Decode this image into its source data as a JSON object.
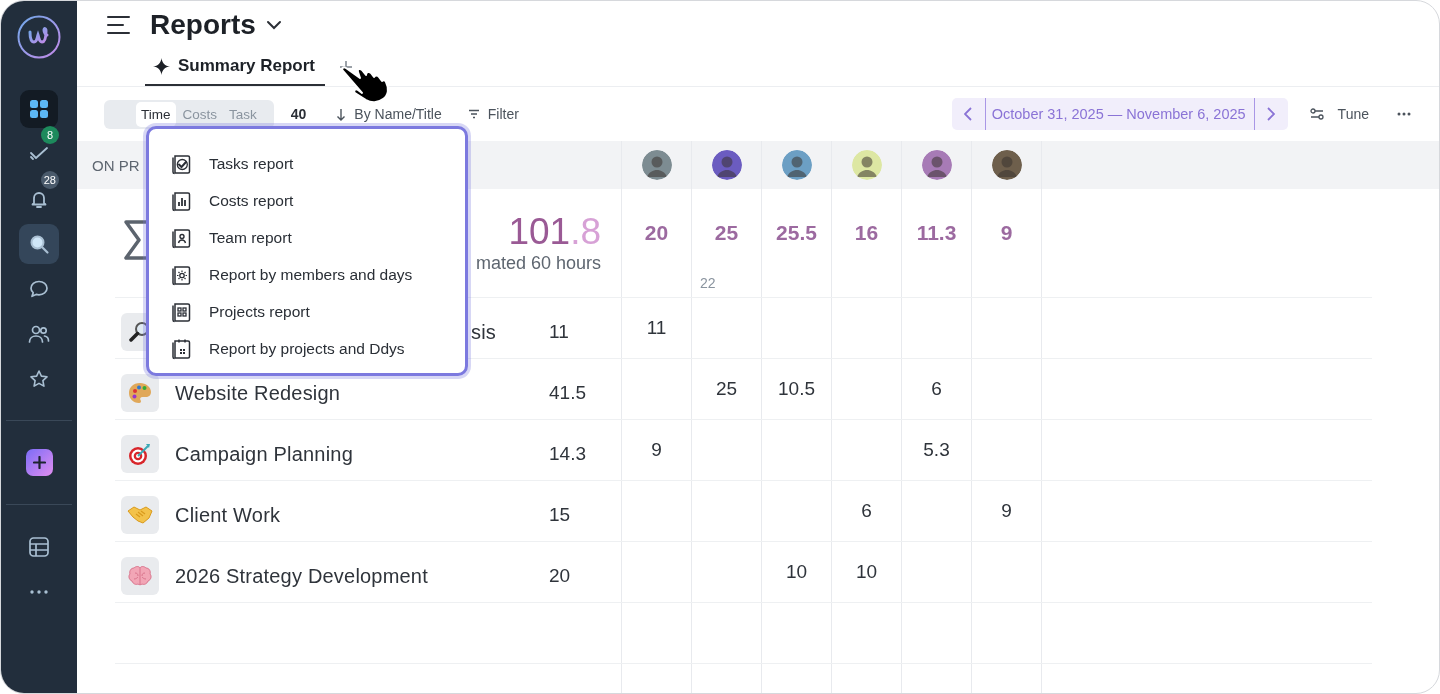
{
  "sidebar": {
    "groups": [
      [
        {
          "kind": "grid",
          "selected": true,
          "hovered": false
        },
        {
          "kind": "tasks",
          "selected": false,
          "hovered": false,
          "badge": "8"
        },
        {
          "kind": "bell",
          "selected": false,
          "hovered": false,
          "badge": "28"
        },
        {
          "kind": "search",
          "selected": false,
          "hovered": true
        },
        {
          "kind": "chat",
          "selected": false,
          "hovered": false
        },
        {
          "kind": "people",
          "selected": false,
          "hovered": false
        },
        {
          "kind": "star",
          "selected": false,
          "hovered": false
        }
      ],
      [
        {
          "kind": "add"
        }
      ],
      [
        {
          "kind": "table",
          "selected": false,
          "hovered": false
        },
        {
          "kind": "more",
          "selected": false,
          "hovered": false
        }
      ]
    ]
  },
  "header": {
    "title": "Reports"
  },
  "tabs": [
    {
      "label": "Summary Report",
      "selected": true
    }
  ],
  "toolbar": {
    "modes": [
      {
        "label": "Time",
        "selected": true
      },
      {
        "label": "Costs",
        "selected": false
      },
      {
        "label": "Task",
        "selected": false
      }
    ],
    "count": "40",
    "sort": "By Name/Title",
    "filter": "Filter",
    "date_range": "October 31, 2025 — November 6, 2025",
    "tune": "Tune"
  },
  "table": {
    "group_label": "ON PR",
    "members": [
      {
        "color": "#7d8c92"
      },
      {
        "color": "#6b5cc0"
      },
      {
        "color": "#6c9fc4"
      },
      {
        "color": "#dde7a3"
      },
      {
        "color": "#a77bb6"
      },
      {
        "color": "#6e5f4c"
      }
    ],
    "summary": {
      "total_whole": "101",
      "total_fraction": ".8",
      "estimate": "mated 60 hours",
      "member_totals": [
        {
          "value": "20"
        },
        {
          "value": "25",
          "sub": "22"
        },
        {
          "value": "25.5"
        },
        {
          "value": "16"
        },
        {
          "value": "11.3"
        },
        {
          "value": "9"
        }
      ]
    },
    "rows": [
      {
        "name": "sis",
        "covered": true,
        "total": "11",
        "values": {
          "member_1": "11"
        }
      },
      {
        "name": "Website Redesign",
        "covered": false,
        "total": "41.5",
        "values": {
          "member_2": "25",
          "member_3": "10.5",
          "member_5": "6"
        }
      },
      {
        "name": "Campaign Planning",
        "covered": false,
        "total": "14.3",
        "values": {
          "member_1": "9",
          "member_5": "5.3"
        }
      },
      {
        "name": "Client Work",
        "covered": false,
        "total": "15",
        "values": {
          "member_4": "6",
          "member_6": "9"
        }
      },
      {
        "name": "2026 Strategy Development",
        "covered": false,
        "total": "20",
        "values": {
          "member_3": "10",
          "member_4": "10"
        }
      }
    ]
  },
  "menu": {
    "items": [
      {
        "label": "Tasks report"
      },
      {
        "label": "Costs report"
      },
      {
        "label": "Team report"
      },
      {
        "label": "Report by members and days"
      },
      {
        "label": "Projects report"
      },
      {
        "label": "Report by projects and Ddys"
      }
    ]
  }
}
